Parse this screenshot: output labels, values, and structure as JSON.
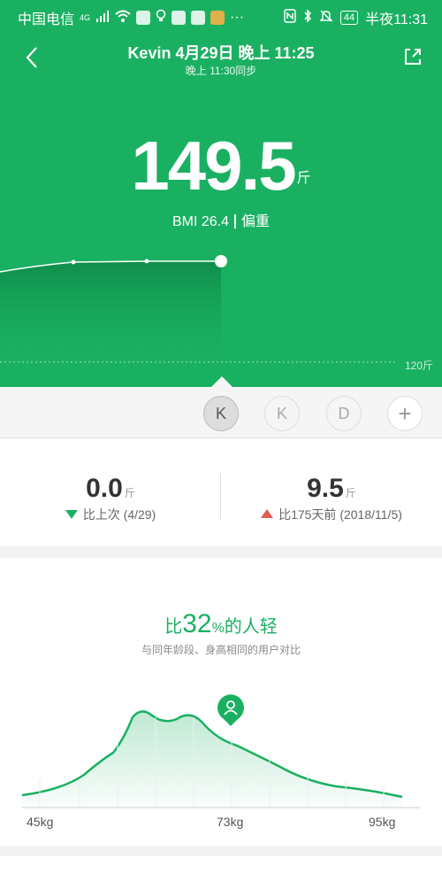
{
  "status_bar": {
    "carrier": "中国电信",
    "network": "4G",
    "battery": "44",
    "time": "半夜11:31"
  },
  "header": {
    "title": "Kevin 4月29日 晚上 11:25",
    "subtitle": "晚上 11:30同步"
  },
  "measurement": {
    "weight": "149.5",
    "unit": "斤",
    "bmi": "BMI 26.4",
    "bmi_status": "偏重",
    "baseline_label": "120斤"
  },
  "users": [
    {
      "label": "K",
      "selected": true
    },
    {
      "label": "K",
      "selected": false
    },
    {
      "label": "D",
      "selected": false
    },
    {
      "label": "+",
      "selected": false
    }
  ],
  "comparison": {
    "last": {
      "value": "0.0",
      "unit": "斤",
      "label": "比上次 (4/29)"
    },
    "past": {
      "value": "9.5",
      "unit": "斤",
      "label": "比175天前 (2018/11/5)"
    }
  },
  "distribution": {
    "prefix": "比",
    "percent": "32",
    "percent_sign": "%",
    "suffix": "的人轻",
    "subtitle": "与同年龄段、身高相同的用户对比",
    "x_labels": [
      "45kg",
      "73kg",
      "95kg"
    ]
  },
  "colors": {
    "brand_green": "#1ab062",
    "up_red": "#e05a4f"
  }
}
